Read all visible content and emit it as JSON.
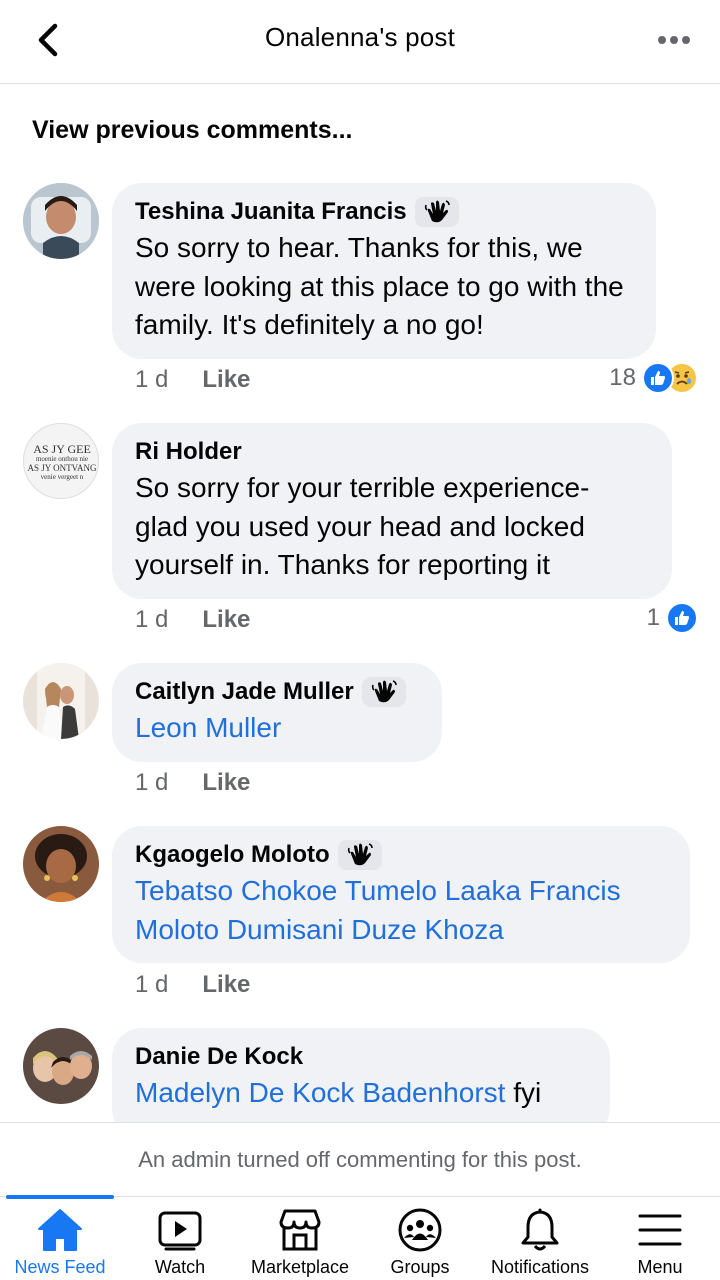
{
  "header": {
    "title": "Onalenna's post",
    "back_icon": "chevron-left-icon",
    "more_icon": "more-horizontal-icon"
  },
  "view_previous": "View previous comments...",
  "comments": [
    {
      "author": "Teshina Juanita Francis",
      "badge": "waving-hand-icon",
      "text": "So sorry to hear. Thanks for this, we were looking at this place to go with the family. It's definitely a no go!",
      "time": "1 d",
      "like": "Like",
      "reaction_count": "18"
    },
    {
      "author": "Ri Holder",
      "avatar_text": [
        "AS JY GEE",
        "moenie onthou nie",
        "AS JY ONTVANG",
        "venie vergeet n"
      ],
      "text": "So sorry for your terrible experience- glad you used your head and locked yourself in. Thanks for reporting it",
      "time": "1 d",
      "like": "Like",
      "reaction_count": "1"
    },
    {
      "author": "Caitlyn Jade Muller",
      "badge": "waving-hand-icon",
      "tags": "Leon Muller",
      "time": "1 d",
      "like": "Like"
    },
    {
      "author": "Kgaogelo Moloto",
      "badge": "waving-hand-icon",
      "tags": "Tebatso Chokoe Tumelo Laaka Francis Moloto Dumisani Duze Khoza",
      "time": "1 d",
      "like": "Like"
    },
    {
      "author": "Danie De Kock",
      "tags": "Madelyn De Kock Badenhorst",
      "text_after": "fyi"
    }
  ],
  "admin_notice": "An admin turned off commenting for this post.",
  "tabs": [
    {
      "label": "News Feed",
      "icon": "home-icon",
      "active": true
    },
    {
      "label": "Watch",
      "icon": "video-icon"
    },
    {
      "label": "Marketplace",
      "icon": "shop-icon"
    },
    {
      "label": "Groups",
      "icon": "groups-icon"
    },
    {
      "label": "Notifications",
      "icon": "bell-icon"
    },
    {
      "label": "Menu",
      "icon": "hamburger-menu-icon"
    }
  ],
  "colors": {
    "accent": "#1877f2",
    "tag_link": "#216fdb",
    "bubble": "#f0f2f5",
    "secondary_text": "#65676b"
  }
}
